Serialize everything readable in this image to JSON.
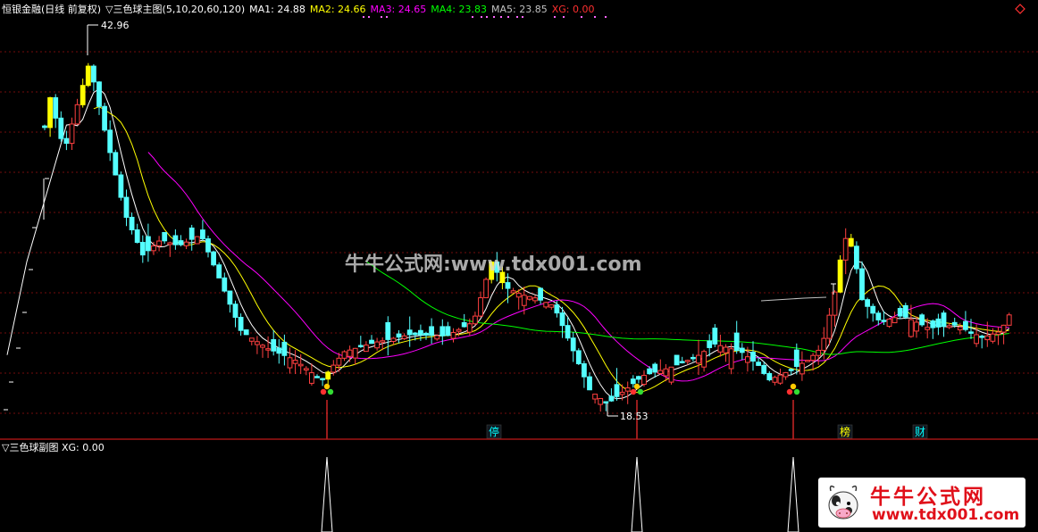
{
  "main_panel": {
    "title": "恒银金融(日线 前复权)",
    "indicator_label": "▽三色球主图(5,10,20,60,120)",
    "ma_readouts": [
      {
        "label": "MA1: 24.88",
        "color": "#ffffff"
      },
      {
        "label": "MA2: 24.66",
        "color": "#ffff00"
      },
      {
        "label": "MA3: 24.65",
        "color": "#ff00ff"
      },
      {
        "label": "MA4: 23.83",
        "color": "#00ff00"
      },
      {
        "label": "MA5: 23.85",
        "color": "#c0c0c0"
      },
      {
        "label": "XG: 0.00",
        "color": "#ff3030"
      }
    ],
    "high_label": "42.96",
    "low_label": "18.53",
    "markers": [
      {
        "text": "停",
        "color": "#00ffff"
      },
      {
        "text": "榜",
        "color": "#ffff00"
      },
      {
        "text": "财",
        "color": "#00ffff"
      }
    ],
    "watermark": "牛牛公式网:www.tdx001.com"
  },
  "sub_panel": {
    "indicator_label": "▽三色球副图",
    "xg_readout": "XG: 0.00"
  },
  "logo": {
    "text_top": "牛牛公式网",
    "text_bottom": "www.tdx001.com"
  },
  "chart_data": {
    "type": "candlestick",
    "price_range": [
      18.53,
      42.96
    ],
    "high": 42.96,
    "low": 18.53,
    "series": [
      {
        "name": "MA1",
        "color": "#ffffff"
      },
      {
        "name": "MA2",
        "color": "#ffff00"
      },
      {
        "name": "MA3",
        "color": "#ff00ff"
      },
      {
        "name": "MA4",
        "color": "#00ff00"
      },
      {
        "name": "MA5",
        "color": "#c0c0c0"
      }
    ],
    "signal_count": 3,
    "colors": {
      "up_candle": "#ff4040",
      "down_candle": "#54ffff",
      "limit_up": "#ffff00",
      "grid": "#9a1010",
      "separator": "#c01818"
    }
  }
}
